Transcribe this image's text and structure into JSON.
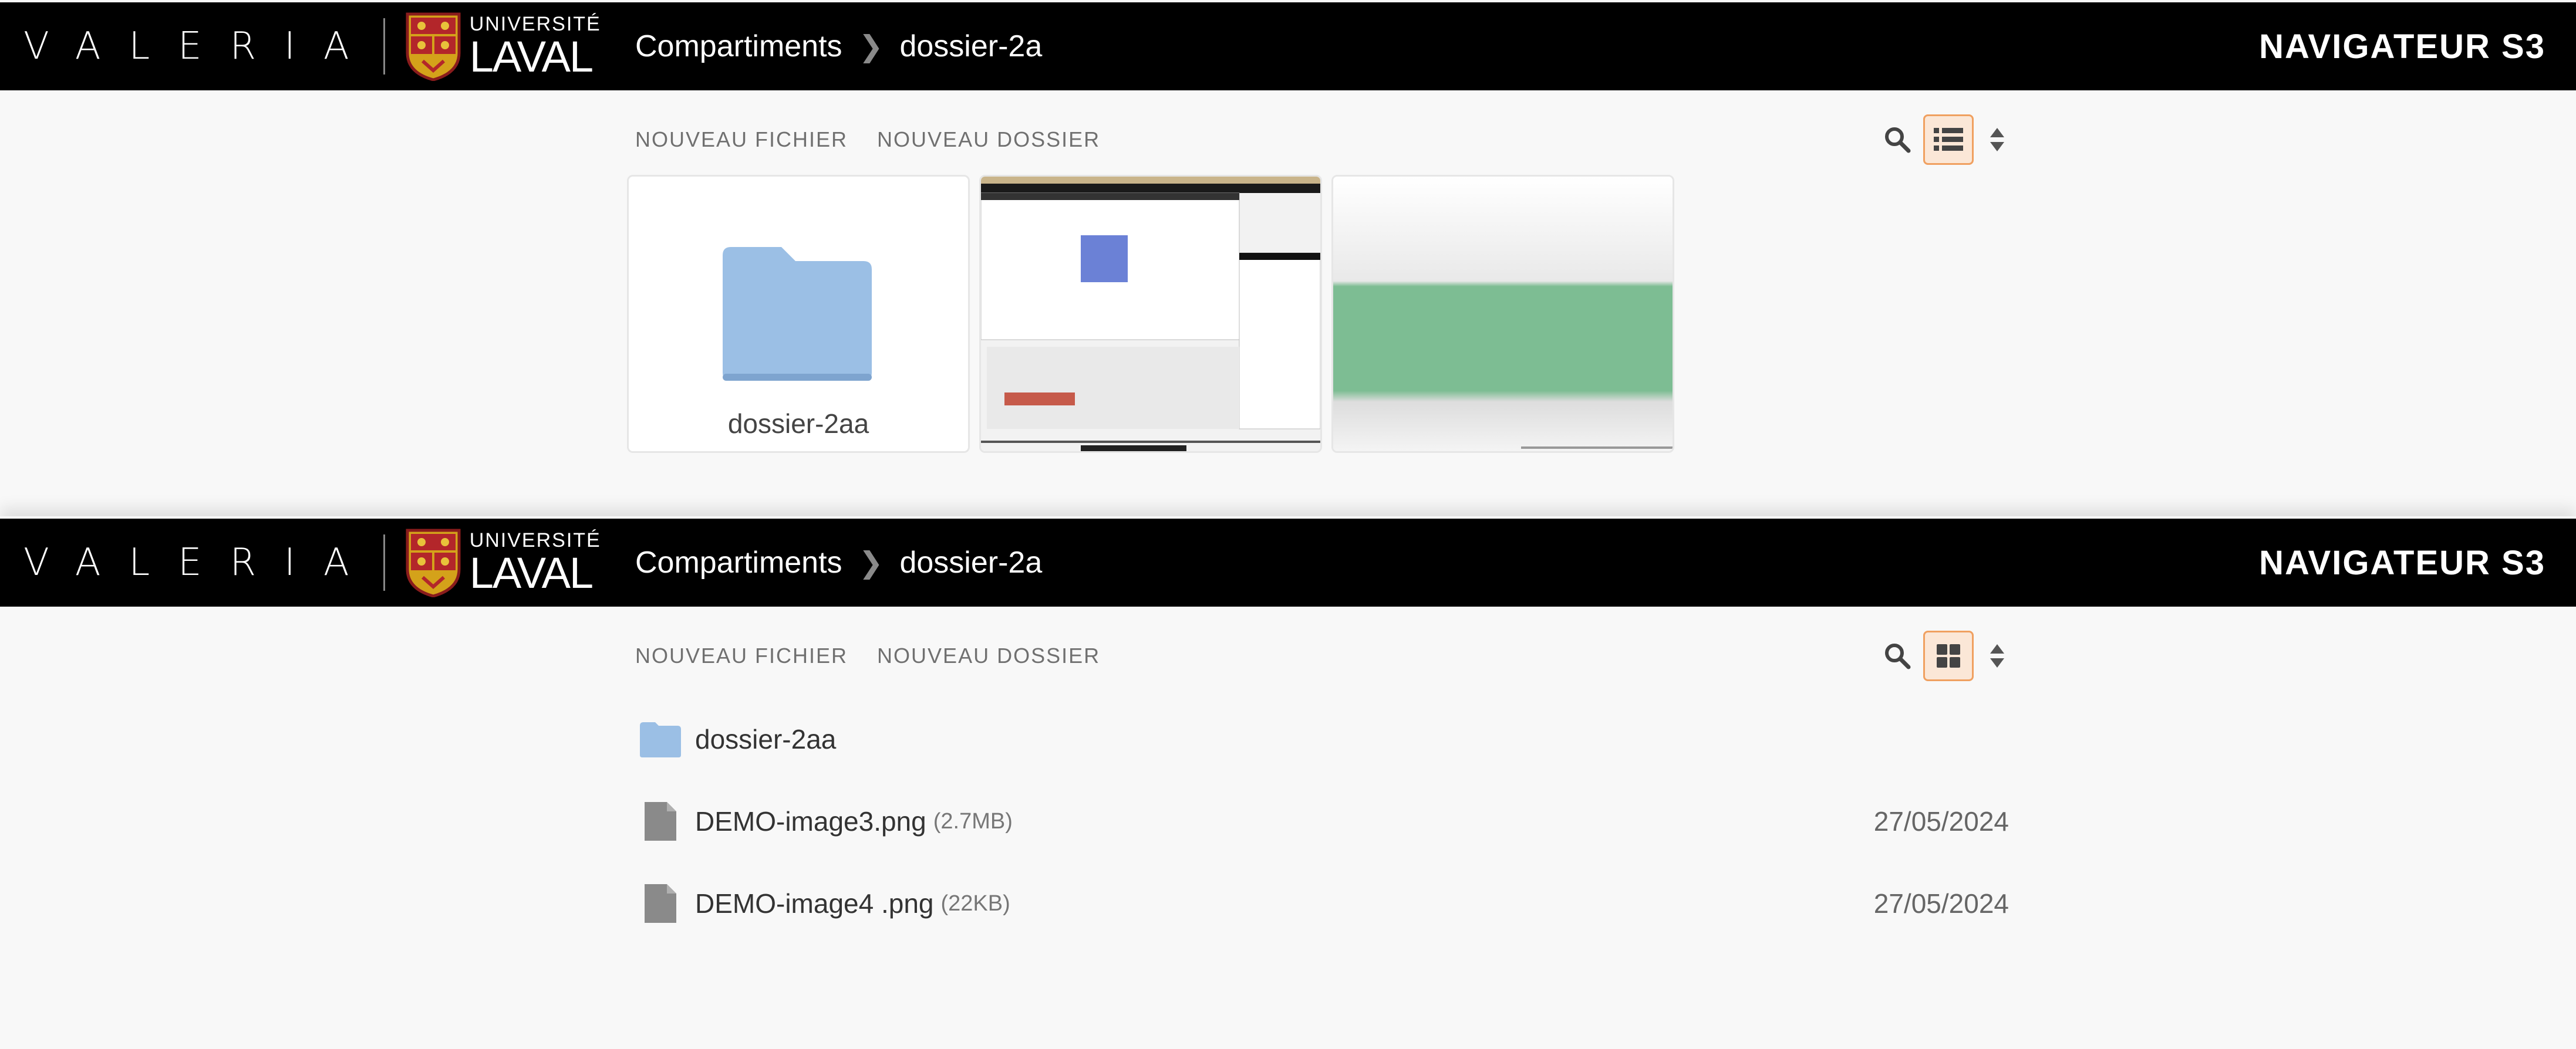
{
  "brand": {
    "valeria": "VALERIA",
    "university_small": "UNIVERSITÉ",
    "university_big": "LAVAL"
  },
  "breadcrumb": {
    "root": "Compartiments",
    "current": "dossier-2a"
  },
  "app_title": "NAVIGATEUR S3",
  "toolbar": {
    "new_file": "NOUVEAU FICHIER",
    "new_folder": "NOUVEAU DOSSIER"
  },
  "grid_view": {
    "active_view_icon": "list-view-icon",
    "tiles": [
      {
        "type": "folder",
        "label": "dossier-2aa",
        "icon": "folder-icon"
      },
      {
        "type": "image-thumbnail",
        "label": "",
        "icon": "screenshot-thumbnail"
      },
      {
        "type": "image-thumbnail",
        "label": "",
        "icon": "green-band-thumbnail"
      }
    ]
  },
  "list_view": {
    "active_view_icon": "grid-view-icon",
    "items": [
      {
        "type": "folder",
        "name": "dossier-2aa",
        "size": "",
        "date": ""
      },
      {
        "type": "file",
        "name": "DEMO-image3.png",
        "size": "(2.7MB)",
        "date": "27/05/2024"
      },
      {
        "type": "file",
        "name": "DEMO-image4 .png",
        "size": "(22KB)",
        "date": "27/05/2024"
      }
    ]
  },
  "colors": {
    "header_bg": "#000000",
    "page_bg": "#f8f8f8",
    "accent_orange": "#f0a060",
    "folder_blue": "#9bbfe5",
    "file_gray": "#8a8a8a",
    "green_band": "#7dbd93"
  }
}
